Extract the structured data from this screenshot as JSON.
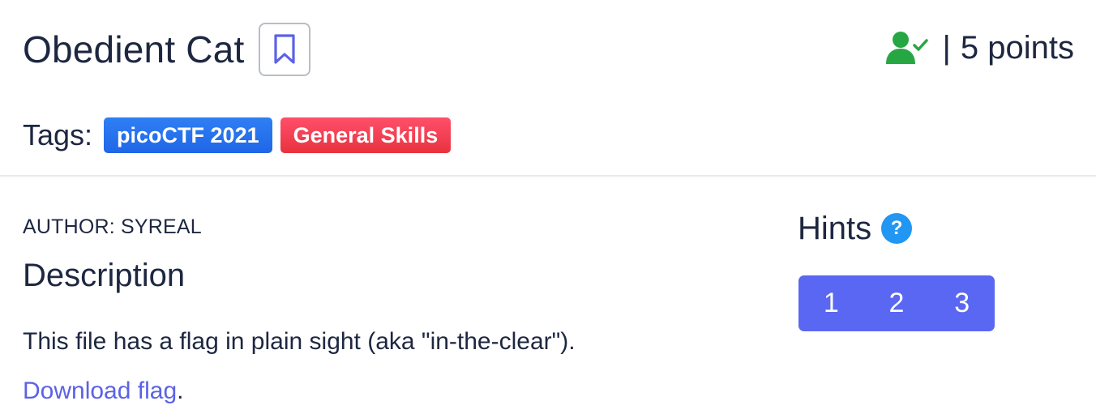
{
  "challenge": {
    "title": "Obedient Cat",
    "points_text": "5 points",
    "separator": "|",
    "tags_label": "Tags:",
    "tags": [
      {
        "label": "picoCTF 2021",
        "color": "#2f7ff3"
      },
      {
        "label": "General Skills",
        "color": "#ff4f6a"
      }
    ]
  },
  "content": {
    "author": "AUTHOR: SYREAL",
    "description_title": "Description",
    "description_text": "This file has a flag in plain sight (aka \"in-the-clear\").",
    "download_link": "Download flag",
    "download_suffix": "."
  },
  "hints": {
    "title": "Hints",
    "help_icon_text": "?",
    "buttons": [
      "1",
      "2",
      "3"
    ]
  },
  "icons": {
    "bookmark": "bookmark-icon",
    "solved": "user-check-icon",
    "help": "question-circle-icon"
  },
  "colors": {
    "accent": "#5b62e6",
    "solved": "#27a744",
    "hint_buttons": "#5a67f2"
  }
}
